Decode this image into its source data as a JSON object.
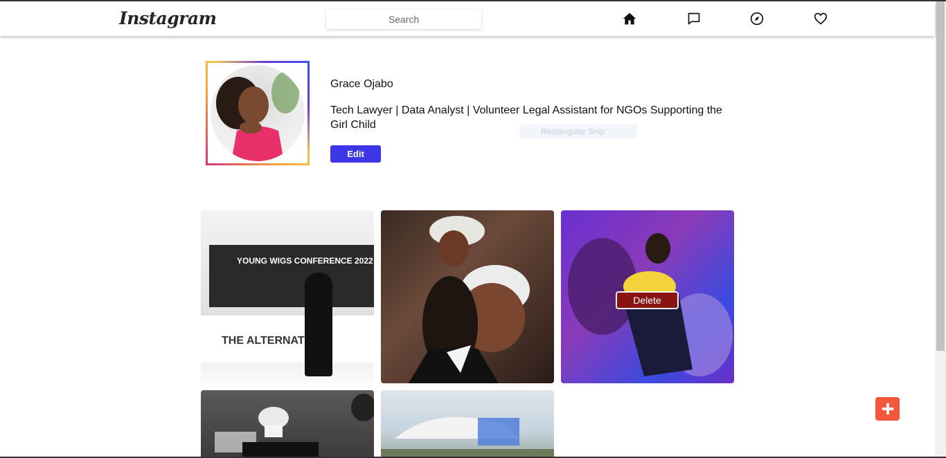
{
  "nav": {
    "logo": "Instagram",
    "search_placeholder": "Search",
    "icons": [
      "home-icon",
      "messages-icon",
      "explore-icon",
      "heart-icon"
    ]
  },
  "profile": {
    "name": "Grace Ojabo",
    "bio": "Tech Lawyer | Data Analyst | Volunteer Legal Assistant for NGOs Supporting the Girl Child",
    "edit_label": "Edit",
    "avatar_ring_colors": [
      "#d0327d",
      "#f4a23a",
      "#6a3bd6",
      "#3a55e6"
    ]
  },
  "overlay": {
    "snip_label": "Rectangular Snip"
  },
  "posts": [
    {
      "caption": "YOUNG WIGS CONFERENCE 2022"
    },
    {
      "caption": ""
    },
    {
      "caption": "",
      "delete_label": "Delete"
    },
    {
      "caption": ""
    },
    {
      "caption": ""
    }
  ],
  "post1_banner": "THE ALTERNATIVE",
  "colors": {
    "accent": "#3d36e6",
    "delete": "#8a1414",
    "fab": "#f4583a"
  }
}
